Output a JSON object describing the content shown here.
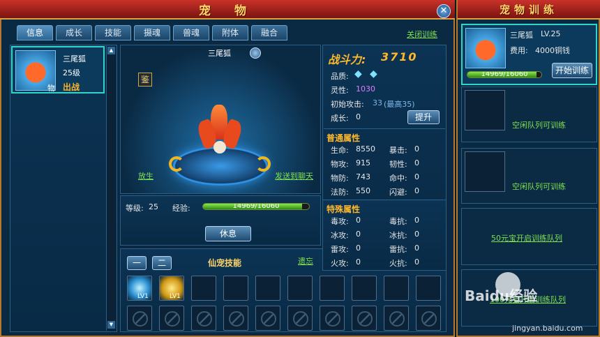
{
  "window": {
    "title": "宠 物",
    "training_title": "宠物训练"
  },
  "tabs": [
    "信息",
    "成长",
    "技能",
    "摄魂",
    "兽魂",
    "附体",
    "融合"
  ],
  "close_training_link": "关闭训练",
  "pet_list": [
    {
      "name": "三尾狐",
      "level": "25级",
      "status": "出战",
      "badge": "物"
    }
  ],
  "pet_view": {
    "name": "三尾狐",
    "appraise": "鉴",
    "release_link": "放生",
    "send_chat_link": "发送到聊天"
  },
  "level_exp": {
    "level_label": "等级:",
    "level_value": "25",
    "exp_label": "经验:",
    "exp_text": "14969/16060",
    "exp_fraction": 0.932
  },
  "rest_button": "休息",
  "skills": {
    "title": "仙宠技能",
    "tab1": "一",
    "tab2": "二",
    "forget_link": "遗忘",
    "learned": [
      "LV1",
      "LV1"
    ]
  },
  "combat": {
    "label": "战斗力:",
    "value": "3710"
  },
  "info": {
    "quality_label": "品质:",
    "spirit_label": "灵性:",
    "spirit_value": "1030",
    "initial_attack_label": "初始攻击:",
    "initial_attack_value": "33",
    "initial_attack_max": "(最高35)",
    "growth_label": "成长:",
    "growth_value": "0",
    "upgrade_button": "提升"
  },
  "normal_attrs": {
    "title": "普通属性",
    "rows": [
      {
        "l": "生命:",
        "lv": "8550",
        "r": "暴击:",
        "rv": "0"
      },
      {
        "l": "物攻:",
        "lv": "915",
        "r": "韧性:",
        "rv": "0"
      },
      {
        "l": "物防:",
        "lv": "743",
        "r": "命中:",
        "rv": "0"
      },
      {
        "l": "法防:",
        "lv": "550",
        "r": "闪避:",
        "rv": "0"
      }
    ]
  },
  "special_attrs": {
    "title": "特殊属性",
    "rows": [
      {
        "l": "毒攻:",
        "lv": "0",
        "r": "毒抗:",
        "rv": "0"
      },
      {
        "l": "冰攻:",
        "lv": "0",
        "r": "冰抗:",
        "rv": "0"
      },
      {
        "l": "雷攻:",
        "lv": "0",
        "r": "雷抗:",
        "rv": "0"
      },
      {
        "l": "火攻:",
        "lv": "0",
        "r": "火抗:",
        "rv": "0"
      }
    ]
  },
  "training": {
    "pet_name": "三尾狐",
    "pet_level": "LV.25",
    "cost_label": "费用:",
    "cost_value": "4000铜钱",
    "start_button": "开始训练",
    "exp_text": "14969/16060",
    "exp_fraction": 0.932,
    "idle_1": "空闲队列可训练",
    "idle_2": "空闲队列可训练",
    "unlock_50": "50元宝开启训练队列",
    "unlock_100": "100元宝开启训练队列"
  },
  "watermark": {
    "brand": "Baidu经验",
    "url": "jingyan.baidu.com"
  }
}
